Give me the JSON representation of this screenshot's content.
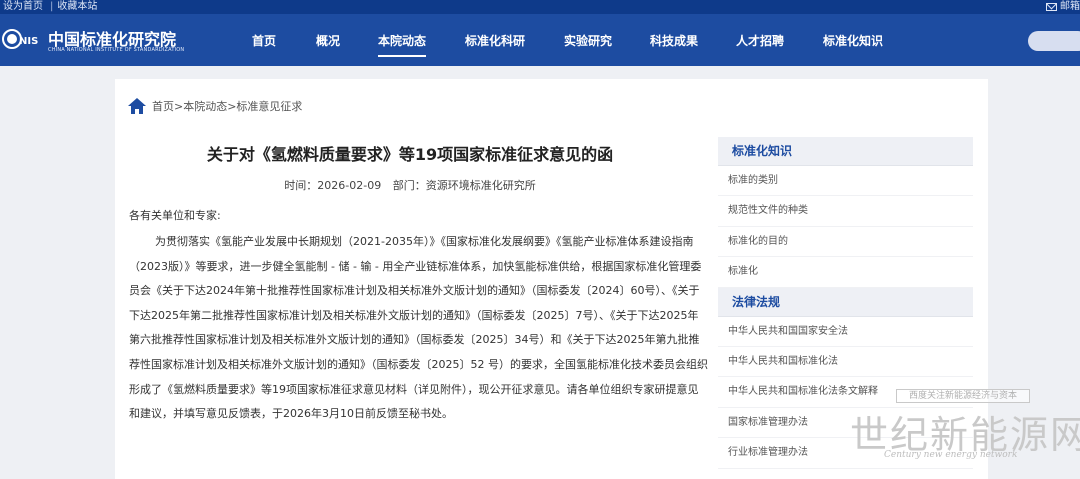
{
  "utilbar": {
    "set_home": "设为首页",
    "bookmark": "收藏本站",
    "mail": "邮箱"
  },
  "logo": {
    "abbr": "NIS",
    "cn": "中国标准化研究院",
    "en": "CHINA NATIONAL INSTITUTE OF STANDARDIZATION"
  },
  "nav": [
    "首页",
    "概况",
    "本院动态",
    "标准化科研",
    "实验研究",
    "科技成果",
    "人才招聘",
    "标准化知识"
  ],
  "breadcrumb": "首页>本院动态>标准意见征求",
  "article": {
    "title": "关于对《氢燃料质量要求》等19项国家标准征求意见的函",
    "time_label": "时间：2026-02-09",
    "dept_label": "部门：资源环境标准化研究所",
    "salutation": "各有关单位和专家:",
    "body": "为贯彻落实《氢能产业发展中长期规划（2021-2035年）》《国家标准化发展纲要》《氢能产业标准体系建设指南（2023版）》等要求，进一步健全氢能制 - 储 - 输 - 用全产业链标准体系，加快氢能标准供给，根据国家标准化管理委员会《关于下达2024年第十批推荐性国家标准计划及相关标准外文版计划的通知》（国标委发〔2024〕60号）、《关于下达2025年第二批推荐性国家标准计划及相关标准外文版计划的通知》（国标委发〔2025〕7号）、《关于下达2025年第六批推荐性国家标准计划及相关标准外文版计划的通知》（国标委发〔2025〕34号）和《关于下达2025年第九批推荐性国家标准计划及相关标准外文版计划的通知》（国标委发〔2025〕52 号）的要求，全国氢能标准化技术委员会组织形成了《氢燃料质量要求》等19项国家标准征求意见材料（详见附件），现公开征求意见。请各单位组织专家研提意见和建议，并填写意见反馈表，于2026年3月10日前反馈至秘书处。"
  },
  "sidebar": {
    "section1": {
      "title": "标准化知识",
      "items": [
        "标准的类别",
        "规范性文件的种类",
        "标准化的目的",
        "标准化"
      ]
    },
    "section2": {
      "title": "法律法规",
      "items": [
        "中华人民共和国国家安全法",
        "中华人民共和国标准化法",
        "中华人民共和国标准化法条文解释",
        "国家标准管理办法",
        "行业标准管理办法"
      ]
    }
  },
  "watermark": {
    "box": "西度关注新能源经济与资本",
    "big": "世纪新能源网",
    "sub": "Century new energy network"
  }
}
